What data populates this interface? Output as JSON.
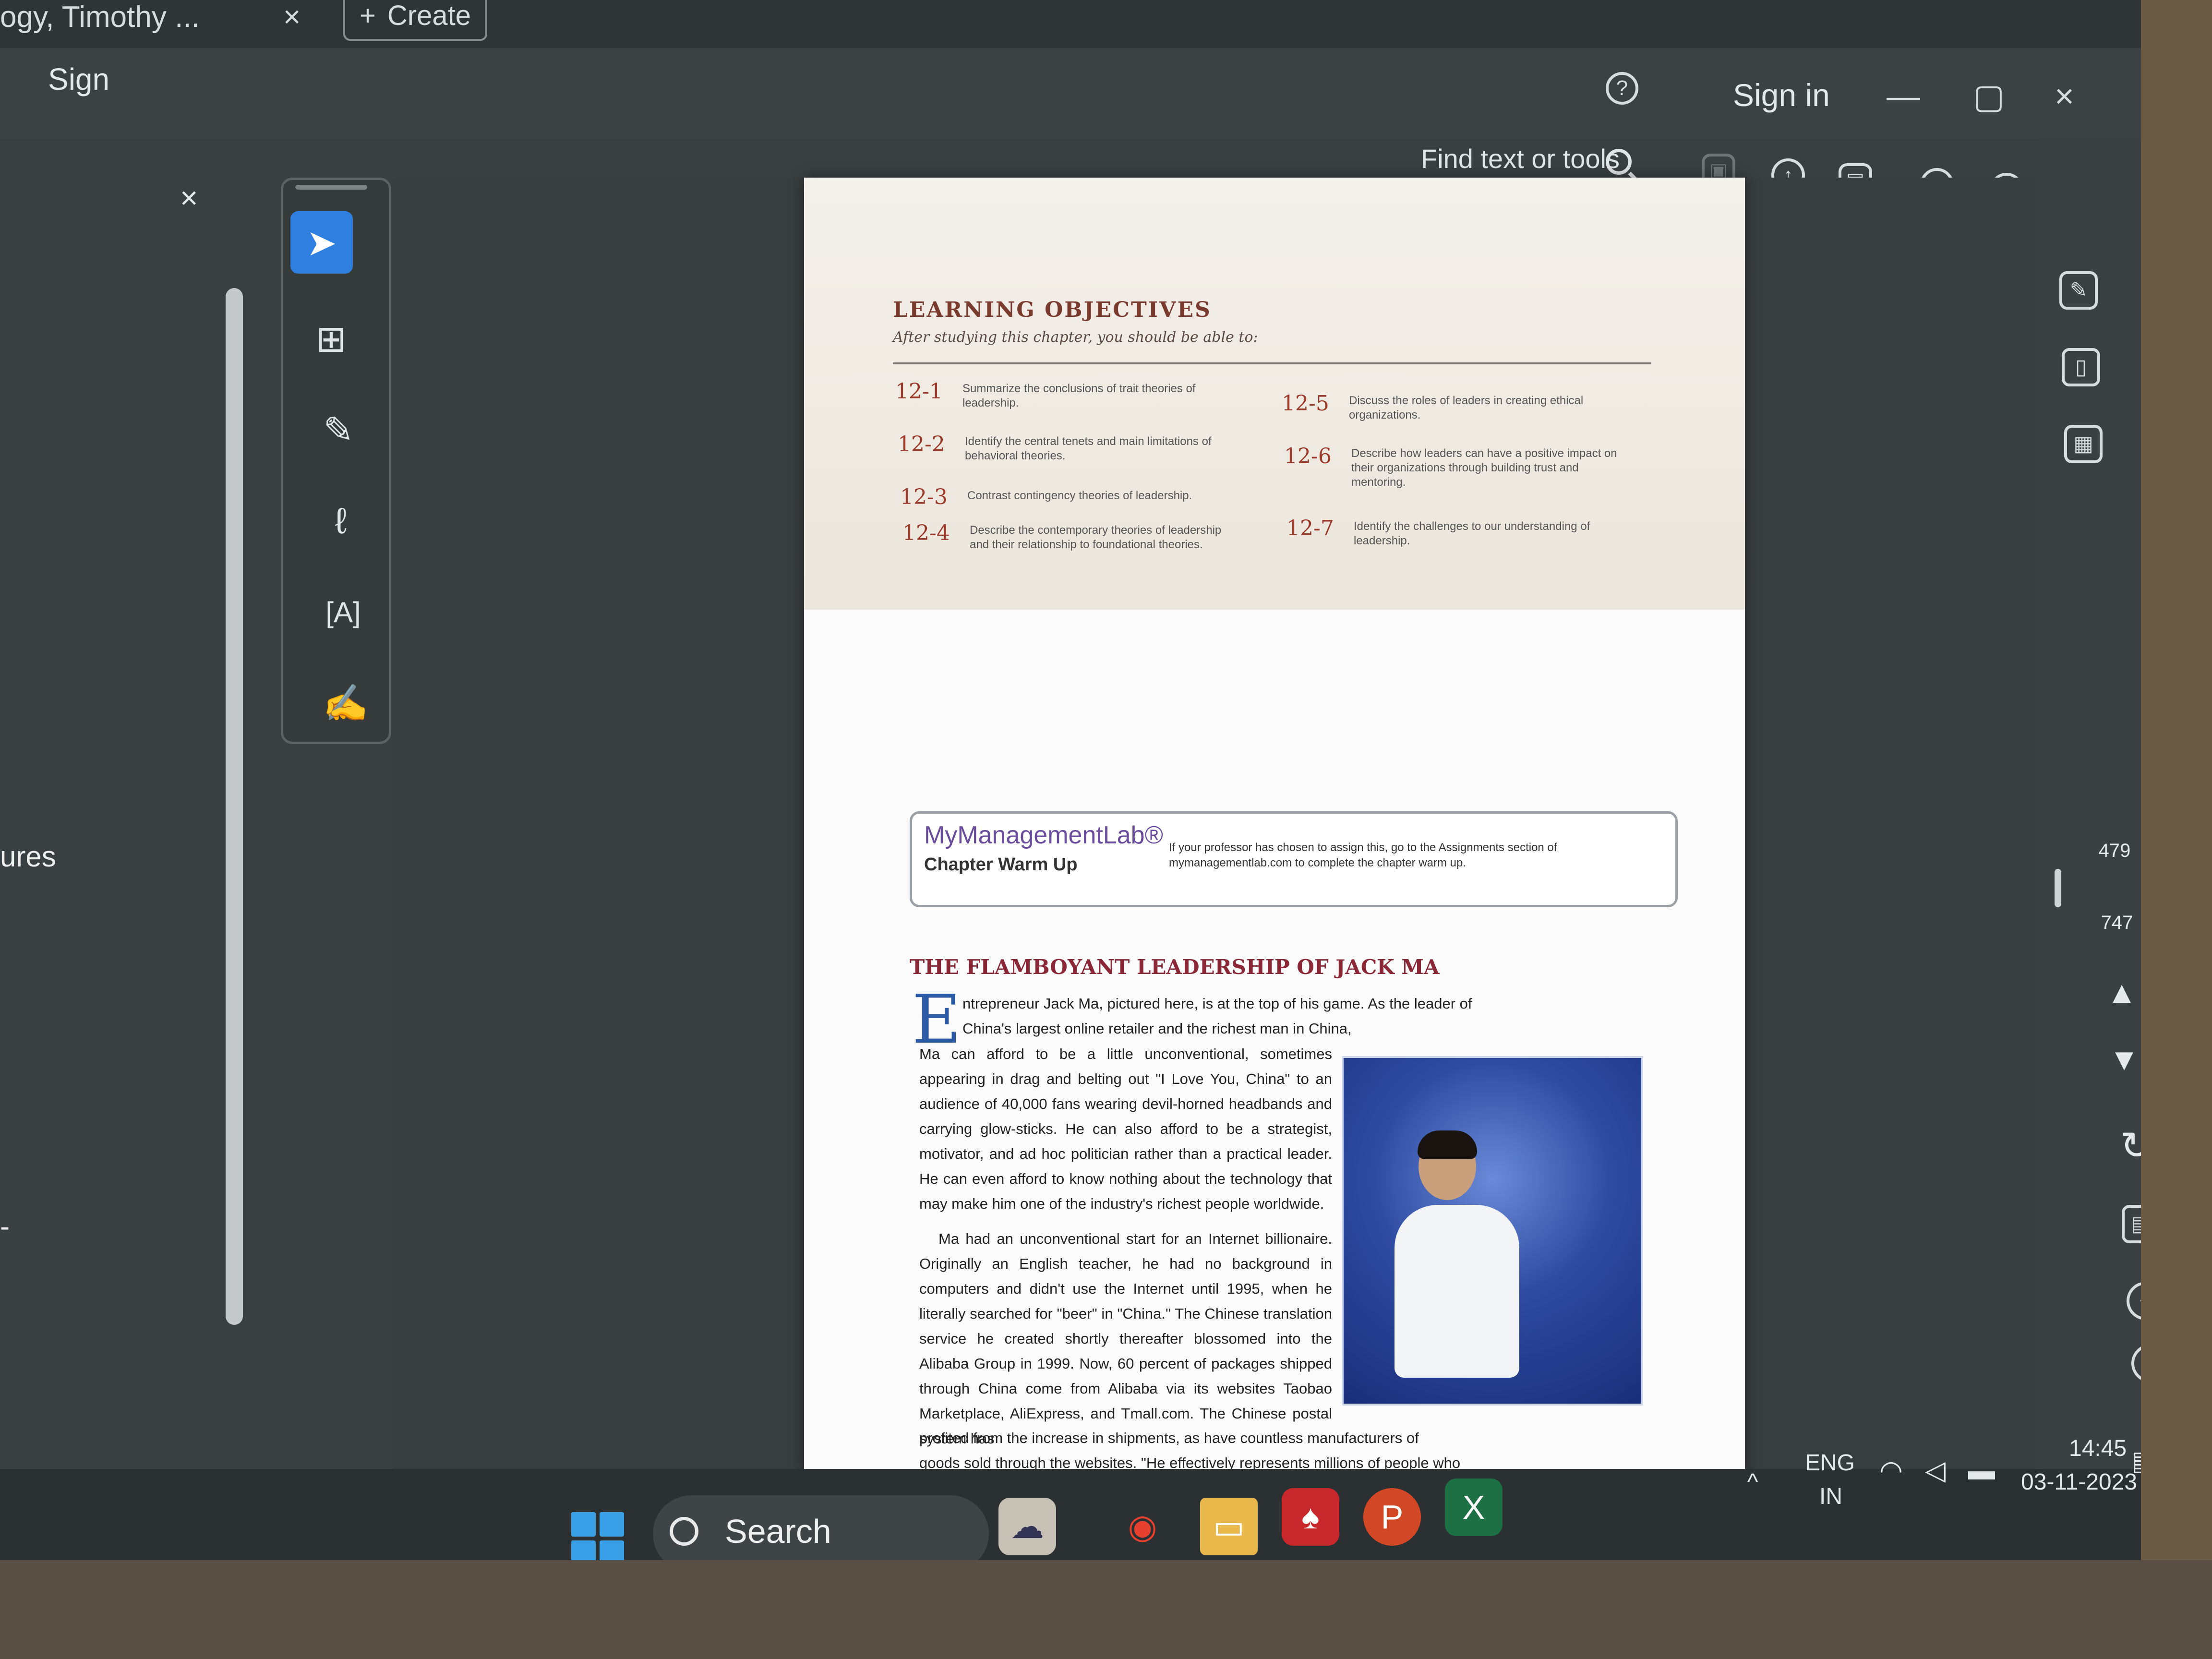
{
  "window": {
    "tab_title": "ogy, Timothy ...",
    "tab_close": "×",
    "create_label": "Create",
    "create_icon": "+"
  },
  "menubar": {
    "sign_label": "Sign",
    "signin_label": "Sign in",
    "help_icon": "?",
    "min_icon": "—",
    "max_icon": "▢",
    "close_icon": "×"
  },
  "toolbar": {
    "find_label": "Find text or tools"
  },
  "left_panel": {
    "close_icon": "×",
    "partial_label": "ures",
    "partial_label2": "-"
  },
  "tools": [
    "select-tool",
    "add-comment-tool",
    "highlight-tool",
    "draw-tool",
    "text-tool",
    "sign-tool"
  ],
  "page_nav": {
    "current_page": "479",
    "total_pages": "747"
  },
  "document": {
    "lo_title": "LEARNING OBJECTIVES",
    "lo_subtitle": "After studying this chapter, you should be able to:",
    "objectives_left": [
      {
        "num": "12-1",
        "text": "Summarize the conclusions of trait theories of leadership."
      },
      {
        "num": "12-2",
        "text": "Identify the central tenets and main limitations of behavioral theories."
      },
      {
        "num": "12-3",
        "text": "Contrast contingency theories of leadership."
      },
      {
        "num": "12-4",
        "text": "Describe the contemporary theories of leadership and their relationship to foundational theories."
      }
    ],
    "objectives_right": [
      {
        "num": "12-5",
        "text": "Discuss the roles of leaders in creating ethical organizations."
      },
      {
        "num": "12-6",
        "text": "Describe how leaders can have a positive impact on their organizations through building trust and mentoring."
      },
      {
        "num": "12-7",
        "text": "Identify the challenges to our understanding of leadership."
      }
    ],
    "mml_brand": "MyManagementLab®",
    "mml_sub": "Chapter Warm Up",
    "mml_desc": "If your professor has chosen to assign this, go to the Assignments section of mymanagementlab.com to complete the chapter warm up.",
    "case_title": "THE FLAMBOYANT LEADERSHIP OF JACK MA",
    "dropcap": "E",
    "para1_first": "ntrepreneur Jack Ma, pictured here, is at the top of his game. As the leader of China's largest online retailer and the richest man in China,",
    "para1_rest": "Ma can afford to be a little unconventional, sometimes appearing in drag and belting out \"I Love You, China\" to an audience of 40,000 fans wearing devil-horned headbands and carrying glow-sticks. He can also afford to be a strategist, motivator, and ad hoc politician rather than a practical leader. He can even afford to know nothing about the technology that may make him one of the industry's richest people worldwide.",
    "para2": "Ma had an unconventional start for an Internet billionaire. Originally an English teacher, he had no background in computers and didn't use the Internet until 1995, when he literally searched for \"beer\" in \"China.\" The Chinese translation service he created shortly thereafter blossomed into the Alibaba Group in 1999. Now, 60 percent of packages shipped through China come from Alibaba via its websites Taobao Marketplace, AliExpress, and Tmall.com. The Chinese postal system has",
    "para3": "profited from the increase in shipments, as have countless manufacturers of goods sold through the websites. \"He effectively represents millions of people who now depend on Alibaba for their livelihood,\" Ma's long time friend Duncan Clark acknowledged."
  },
  "taskbar": {
    "search_label": "Search",
    "lang_line1": "ENG",
    "lang_line2": "IN",
    "time": "14:45",
    "date": "03-11-2023",
    "chevron": "^"
  },
  "colors": {
    "accent": "#2f7fe0",
    "objective_number": "#9a3a2a",
    "case_title": "#8a2838",
    "mml_brand": "#6a4c9c"
  }
}
